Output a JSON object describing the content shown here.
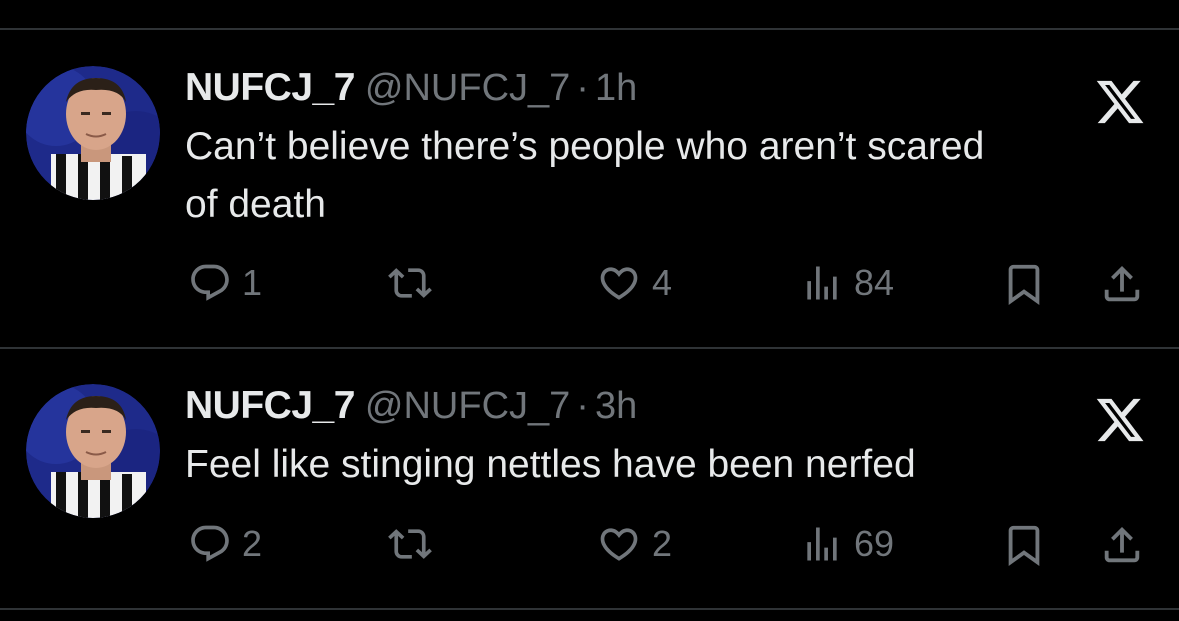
{
  "tweets": [
    {
      "display_name": "NUFCJ_7",
      "handle": "@NUFCJ_7",
      "separator": "·",
      "time": "1h",
      "text_line1": "Can’t believe there’s people who aren’t scared",
      "text_line2": "of death",
      "replies": "1",
      "likes": "4",
      "views": "84"
    },
    {
      "display_name": "NUFCJ_7",
      "handle": "@NUFCJ_7",
      "separator": "·",
      "time": "3h",
      "text_line1": "Feel like stinging nettles have been nerfed",
      "text_line2": "",
      "replies": "2",
      "likes": "2",
      "views": "69"
    }
  ],
  "colors": {
    "background": "#000000",
    "primary_text": "#e7e9ea",
    "secondary_text": "#71767b",
    "divider": "#2f3336"
  },
  "icons": [
    "x-logo-icon",
    "reply-icon",
    "retweet-icon",
    "like-icon",
    "views-icon",
    "bookmark-icon",
    "share-icon"
  ]
}
